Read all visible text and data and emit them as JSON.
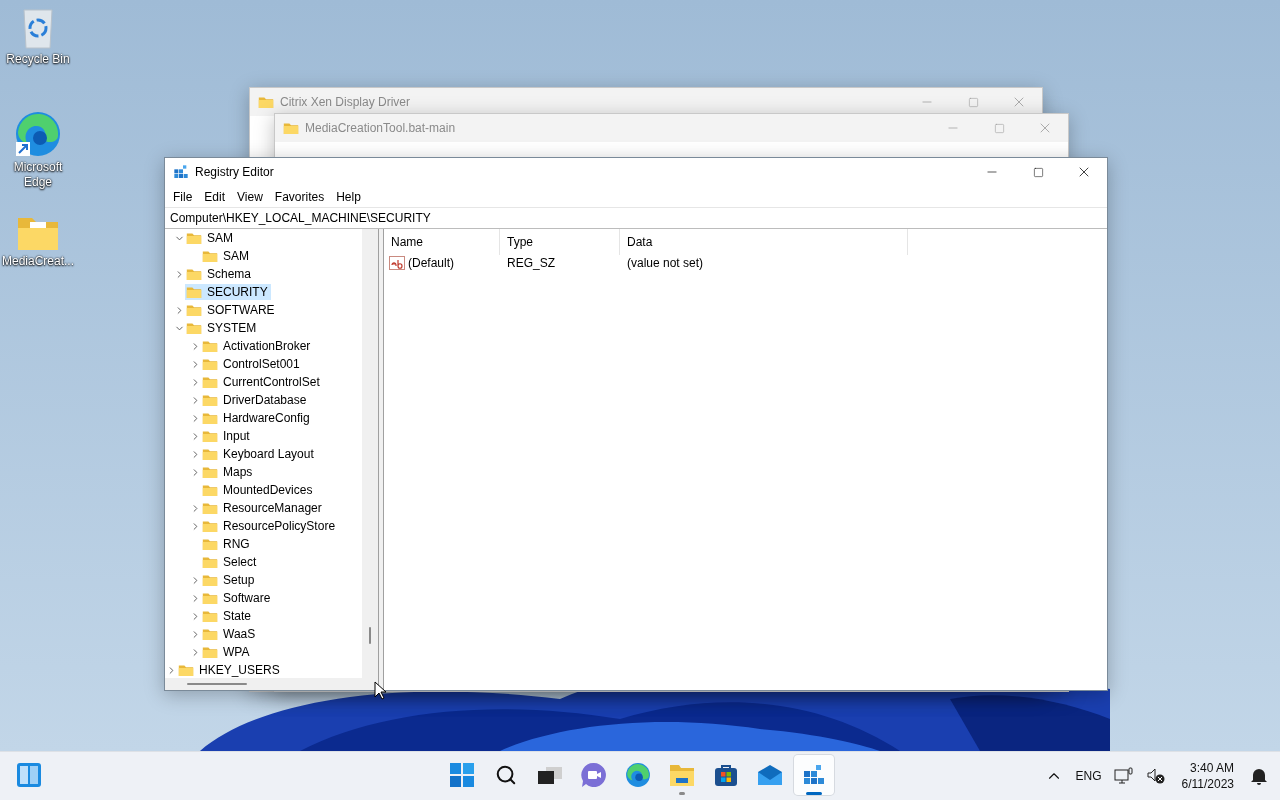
{
  "desktop_icons": [
    {
      "kind": "recycle-bin",
      "label": "Recycle Bin"
    },
    {
      "kind": "edge",
      "label": "Microsoft Edge"
    },
    {
      "kind": "folder",
      "label": "MediaCreat..."
    }
  ],
  "background_windows": [
    {
      "title": "Citrix Xen Display Driver"
    },
    {
      "title": "MediaCreationTool.bat-main"
    }
  ],
  "registry_window": {
    "title": "Registry Editor",
    "menu": [
      "File",
      "Edit",
      "View",
      "Favorites",
      "Help"
    ],
    "address": "Computer\\HKEY_LOCAL_MACHINE\\SECURITY",
    "tree": {
      "items": [
        {
          "children": [
            {
              "label": "SAM",
              "expanded": true,
              "selected": false,
              "children": [
                {
                  "label": "SAM",
                  "selected": false
                }
              ]
            },
            {
              "label": "Schema",
              "expanded": false,
              "selected": false
            },
            {
              "label": "SECURITY",
              "selected": true
            },
            {
              "label": "SOFTWARE",
              "expanded": false,
              "selected": false
            },
            {
              "label": "SYSTEM",
              "expanded": true,
              "selected": false,
              "children": [
                {
                  "label": "ActivationBroker",
                  "expanded": false,
                  "selected": false
                },
                {
                  "label": "ControlSet001",
                  "expanded": false,
                  "selected": false
                },
                {
                  "label": "CurrentControlSet",
                  "expanded": false,
                  "selected": false
                },
                {
                  "label": "DriverDatabase",
                  "expanded": false,
                  "selected": false
                },
                {
                  "label": "HardwareConfig",
                  "expanded": false,
                  "selected": false
                },
                {
                  "label": "Input",
                  "expanded": false,
                  "selected": false
                },
                {
                  "label": "Keyboard Layout",
                  "expanded": false,
                  "selected": false
                },
                {
                  "label": "Maps",
                  "expanded": false,
                  "selected": false
                },
                {
                  "label": "MountedDevices",
                  "selected": false
                },
                {
                  "label": "ResourceManager",
                  "expanded": false,
                  "selected": false
                },
                {
                  "label": "ResourcePolicyStore",
                  "expanded": false,
                  "selected": false
                },
                {
                  "label": "RNG",
                  "selected": false
                },
                {
                  "label": "Select",
                  "selected": false
                },
                {
                  "label": "Setup",
                  "expanded": false,
                  "selected": false
                },
                {
                  "label": "Software",
                  "expanded": false,
                  "selected": false
                },
                {
                  "label": "State",
                  "expanded": false,
                  "selected": false
                },
                {
                  "label": "WaaS",
                  "expanded": false,
                  "selected": false
                },
                {
                  "label": "WPA",
                  "expanded": false,
                  "selected": false
                }
              ]
            }
          ]
        },
        {
          "label": "HKEY_USERS",
          "expanded": false,
          "selected": false
        }
      ]
    },
    "values": {
      "columns": [
        "Name",
        "Type",
        "Data"
      ],
      "rows": [
        {
          "name": "(Default)",
          "type": "REG_SZ",
          "data": "(value not set)"
        }
      ]
    }
  },
  "taskbar": {
    "apps": [
      {
        "kind": "start",
        "running": false,
        "active": false
      },
      {
        "kind": "search",
        "running": false,
        "active": false
      },
      {
        "kind": "task-view",
        "running": false,
        "active": false
      },
      {
        "kind": "chat",
        "running": false,
        "active": false
      },
      {
        "kind": "edge",
        "running": false,
        "active": false
      },
      {
        "kind": "explorer",
        "running": true,
        "active": false
      },
      {
        "kind": "store",
        "running": false,
        "active": false
      },
      {
        "kind": "mail",
        "running": false,
        "active": false
      },
      {
        "kind": "regedit",
        "running": true,
        "active": true
      }
    ],
    "language": "ENG",
    "time": "3:40 AM",
    "date": "6/11/2023"
  }
}
